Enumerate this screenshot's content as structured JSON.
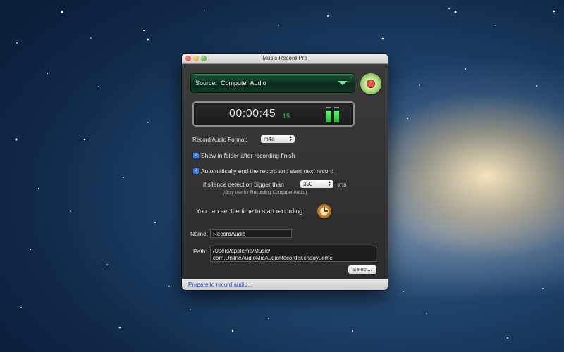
{
  "window": {
    "title": "Music Record Pro"
  },
  "source": {
    "label": "Source:",
    "value": "Computer Audio"
  },
  "timer": {
    "time": "00:00:45",
    "frames": "15"
  },
  "format": {
    "label": "Record Audio Format:",
    "value": "m4a"
  },
  "options": {
    "show_in_folder": {
      "checked": true,
      "label": "Show in folder after recording finish"
    },
    "auto_end": {
      "checked": true,
      "label": "Automatically end the record and start next record"
    },
    "silence": {
      "prefix": "if silence detection bigger than",
      "value": "300",
      "unit": "ms"
    },
    "silence_note": "(Only use for Recording Computer Audio)"
  },
  "schedule": {
    "text": "You can set the time to start recording:"
  },
  "name_field": {
    "label": "Name:",
    "value": "RecordAudio"
  },
  "path_field": {
    "label": "Path:",
    "line1": "/Users/appleme/Music/",
    "line2": "com.OnlineAudioMicAudioRecorder.chaoyueme"
  },
  "select_button": {
    "label": "Select..."
  },
  "status": {
    "text": "Prepare to record audio..."
  },
  "colors": {
    "accent_green": "#27e33f",
    "status_blue": "#2652d4",
    "source_green": "#1c5a3a"
  }
}
